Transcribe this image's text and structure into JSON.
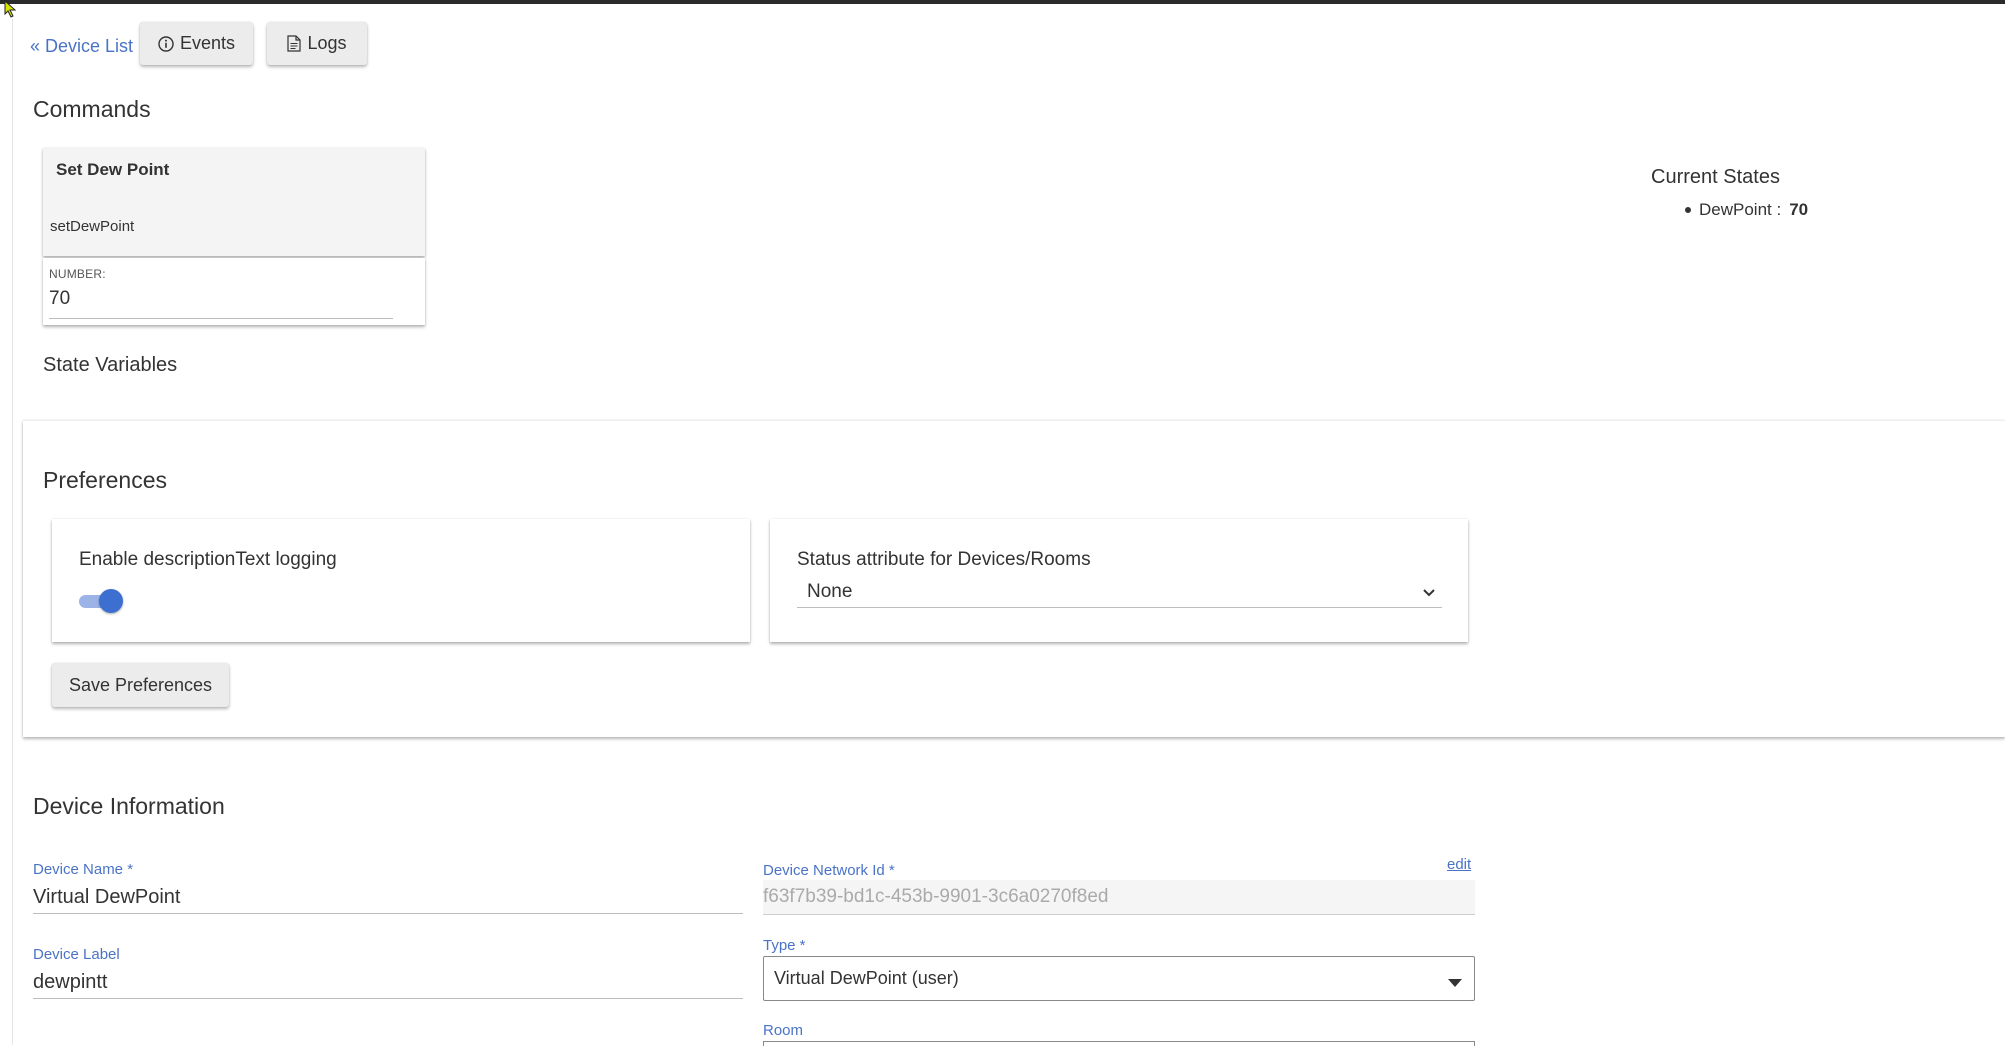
{
  "nav": {
    "device_list_link": "« Device List",
    "events_button": "Events",
    "logs_button": "Logs"
  },
  "commands": {
    "heading": "Commands",
    "card": {
      "title": "Set Dew Point",
      "method": "setDewPoint",
      "param_label": "NUMBER:",
      "param_value": "70"
    }
  },
  "current_states": {
    "heading": "Current States",
    "items": [
      {
        "name": "DewPoint :",
        "value": "70"
      }
    ]
  },
  "state_variables": {
    "heading": "State Variables"
  },
  "preferences": {
    "heading": "Preferences",
    "logging_label": "Enable descriptionText logging",
    "logging_enabled": true,
    "status_attr_label": "Status attribute for Devices/Rooms",
    "status_attr_value": "None",
    "save_button": "Save Preferences"
  },
  "device_info": {
    "heading": "Device Information",
    "device_name_label": "Device Name *",
    "device_name_value": "Virtual DewPoint",
    "network_id_label": "Device Network Id *",
    "network_id_value": "f63f7b39-bd1c-453b-9901-3c6a0270f8ed",
    "edit_link": "edit",
    "device_label_label": "Device Label",
    "device_label_value": "dewpintt",
    "type_label": "Type *",
    "type_value": "Virtual DewPoint (user)",
    "room_label": "Room"
  },
  "colors": {
    "accent": "#4a73c7",
    "toggle": "#3d6fd1",
    "topbar": "#2b2b2b"
  }
}
